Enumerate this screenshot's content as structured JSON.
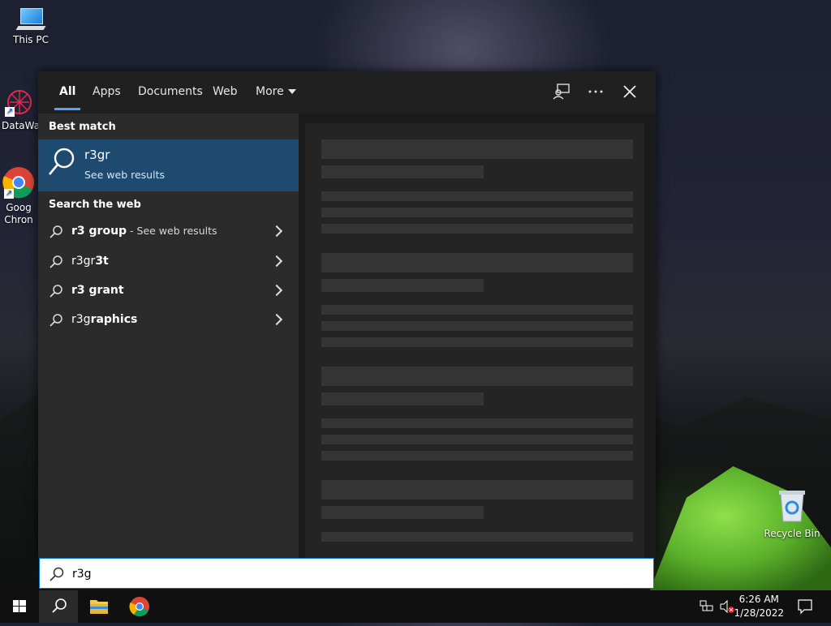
{
  "desktop": {
    "icons": [
      {
        "label": "This PC"
      },
      {
        "label": "DataWag"
      },
      {
        "label": "Goog\nChron"
      },
      {
        "label": "Recycle Bin"
      }
    ]
  },
  "start_menu": {
    "tabs": [
      "All",
      "Apps",
      "Documents",
      "Web",
      "More"
    ],
    "best_match": {
      "heading": "Best match",
      "name": "r3gr",
      "subtitle": "See web results"
    },
    "search_web": {
      "heading": "Search the web",
      "items": [
        {
          "prefix": "r3",
          "bold": " group",
          "hint": " - See web results"
        },
        {
          "prefix": "r3gr",
          "bold": "3t",
          "hint": ""
        },
        {
          "prefix": "r3",
          "bold": " grant",
          "hint": ""
        },
        {
          "prefix": "r3g",
          "bold": "raphics",
          "hint": ""
        }
      ]
    }
  },
  "search_box": {
    "value": "r3g"
  },
  "taskbar": {
    "time": "6:26 AM",
    "date": "1/28/2022"
  },
  "colors": {
    "accent": "#4ca5ff",
    "selection": "#1d4a6e",
    "taskbar": "#101010"
  }
}
